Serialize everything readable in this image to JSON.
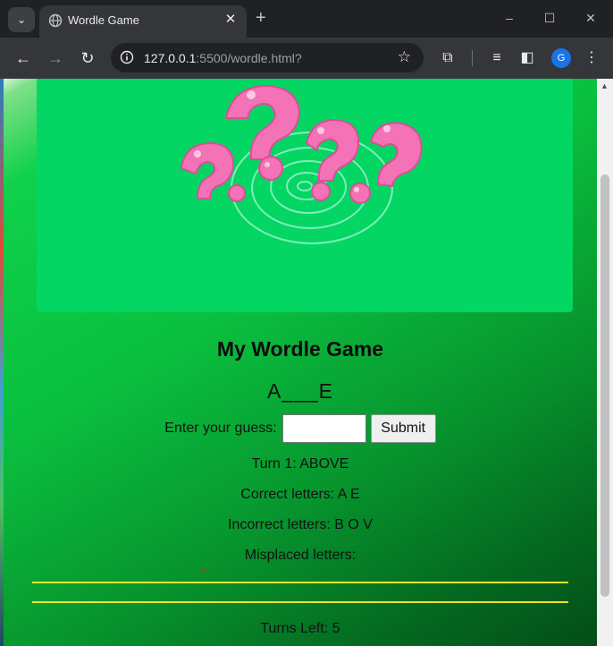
{
  "browser": {
    "tab_title": "Wordle Game",
    "url_host": "127.0.0.1",
    "url_rest": ":5500/wordle.html?",
    "profile_initial": "G"
  },
  "game": {
    "title": "My Wordle Game",
    "masked_word": "A___E",
    "guess_label": "Enter your guess:",
    "guess_value": "",
    "submit_label": "Submit",
    "turn_text": "Turn 1: ABOVE",
    "correct_text": "Correct letters: A E",
    "incorrect_text": "Incorrect letters: B O V",
    "misplaced_text": "Misplaced letters:",
    "turns_left_text": "Turns Left: 5"
  },
  "colors": {
    "hero_bg": "#04d663",
    "question_mark": "#f472b6",
    "divider": "#e6e62a"
  }
}
